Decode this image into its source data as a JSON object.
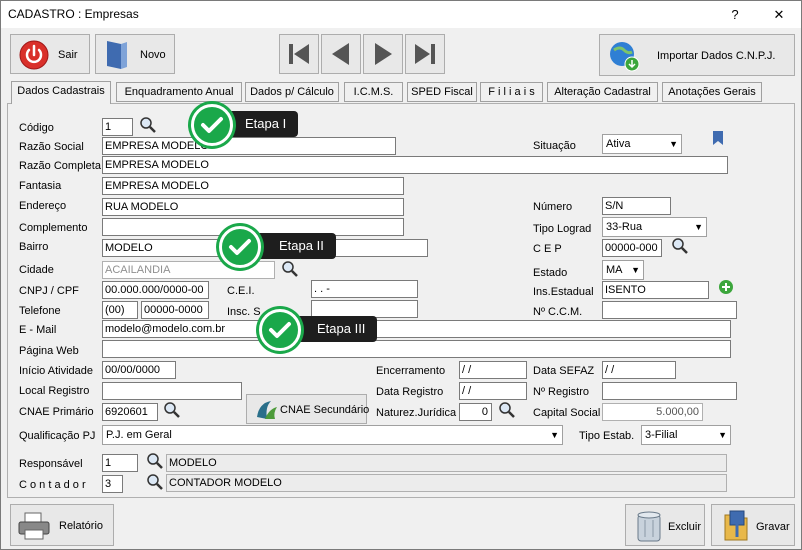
{
  "window": {
    "title": "CADASTRO : Empresas",
    "help": "?",
    "close": "✕"
  },
  "toolbar": {
    "sair": "Sair",
    "novo": "Novo",
    "importar": "Importar Dados C.N.P.J.",
    "relatorio": "Relatório",
    "excluir": "Excluir",
    "gravar": "Gravar"
  },
  "tabs": [
    "Dados Cadastrais",
    "Enquadramento Anual",
    "Dados p/ Cálculo",
    "I.C.M.S.",
    "SPED Fiscal",
    "F i l i a i s",
    "Alteração Cadastral",
    "Anotações Gerais"
  ],
  "callouts": {
    "etapa1": "Etapa I",
    "etapa2": "Etapa II",
    "etapa3": "Etapa III"
  },
  "labels": {
    "codigo": "Código",
    "razao_social": "Razão Social",
    "razao_completa": "Razão Completa",
    "fantasia": "Fantasia",
    "endereco": "Endereço",
    "complemento": "Complemento",
    "bairro": "Bairro",
    "cidade": "Cidade",
    "cnpj": "CNPJ / CPF",
    "telefone": "Telefone",
    "email": "E - Mail",
    "pagina_web": "Página Web",
    "inicio_atividade": "Início Atividade",
    "local_registro": "Local Registro",
    "cnae_primario": "CNAE Primário",
    "qualificacao_pj": "Qualificação PJ",
    "responsavel": "Responsável",
    "contador": "C o n t a d o r",
    "situacao": "Situação",
    "numero": "Número",
    "tipo_lograd": "Tipo Lograd",
    "cep": "C E P",
    "estado": "Estado",
    "ins_estadual": "Ins.Estadual",
    "ccm": "Nº  C.C.M.",
    "cei": "C.E.I.",
    "insc_s": "Insc. S",
    "encerramento": "Encerramento",
    "data_registro": "Data Registro",
    "naturez_juridica": "Naturez.Jurídica",
    "data_sefaz": "Data SEFAZ",
    "n_registro": "Nº Registro",
    "capital_social": "Capital Social",
    "tipo_estab": "Tipo Estab.",
    "cnae_secundario": "CNAE Secundário"
  },
  "values": {
    "codigo": "1",
    "razao_social": "EMPRESA MODELO",
    "razao_completa": "EMPRESA MODELO",
    "fantasia": "EMPRESA MODELO",
    "endereco": "RUA MODELO",
    "complemento": "",
    "bairro": "MODELO",
    "cidade": "ACAILANDIA",
    "cnpj": "00.000.000/0000-00",
    "cei": " .    .    -",
    "telefone_ddd": "(00)",
    "telefone": "00000-0000",
    "email": "modelo@modelo.com.br",
    "pagina_web": "",
    "inicio_atividade": "00/00/0000",
    "local_registro": "",
    "cnae_primario": "6920601",
    "qualificacao_pj": "P.J. em Geral",
    "responsavel_cod": "1",
    "responsavel_nome": "MODELO",
    "contador_cod": "3",
    "contador_nome": "CONTADOR MODELO",
    "situacao": "Ativa",
    "numero": "S/N",
    "tipo_lograd": "33-Rua",
    "cep": "00000-000",
    "estado": "MA",
    "ins_estadual": "ISENTO",
    "ccm": "",
    "encerramento": " / /",
    "data_registro": " / /",
    "naturez_juridica": "0",
    "data_sefaz": " / /",
    "n_registro": "",
    "capital_social": "5.000,00",
    "tipo_estab": "3-Filial"
  },
  "colors": {
    "accent_green": "#1aa84a",
    "callout_bg": "#1e1e1e",
    "sair_red": "#d9302a"
  }
}
